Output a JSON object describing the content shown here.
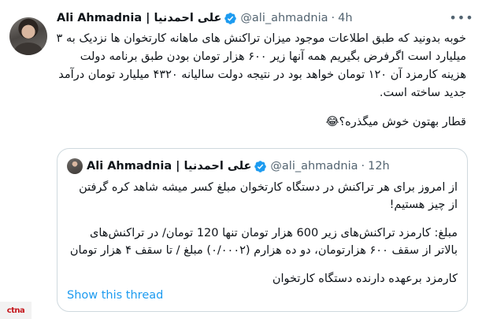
{
  "tweet": {
    "author_name_en": "Ali Ahmadnia",
    "author_name_sep": "|",
    "author_name_fa": "علی احمدنیا",
    "handle": "@ali_ahmadnia",
    "separator": "·",
    "time": "4h",
    "more_icon": "more-horizontal-icon",
    "verified_color": "#1d9bf0",
    "body_lines": [
      "خوبه بدونید که طبق اطلاعات موجود میزان تراکنش های ماهانه کارتخوان ها نزدیک به ۳ میلیارد است اگرفرض بگیریم همه آنها زیر ۶۰۰ هزار تومان بودن طبق برنامه دولت هزینه کارمزد آن ۱۲۰ تومان خواهد بود در نتیجه دولت سالیانه ۴۳۲۰ میلیارد تومان درآمد جدید ساخته است.",
      "قطار بهتون خوش میگذره؟😂"
    ]
  },
  "quoted_tweet": {
    "author_name_en": "Ali Ahmadnia",
    "author_name_sep": "|",
    "author_name_fa": "علی احمدنیا",
    "handle": "@ali_ahmadnia",
    "separator": "·",
    "time": "12h",
    "paragraphs": [
      "از امروز برای هر تراکنش در دستگاه کارتخوان مبلغ کسر میشه شاهد کره گرفتن از چیز هستیم!",
      "مبلغ: کارمزد تراکنش‌های زیر 600 هزار تومان تنها 120 تومان/ در تراکنش‌های بالاتر از سقف ۶۰۰ هزارتومان، دو ده هزارم (۰/۰۰۰۲) مبلغ / تا سقف ۴ هزار تومان",
      "کارمزد برعهده دارنده دستگاه کارتخوان"
    ],
    "show_thread": "Show this thread"
  },
  "watermark": {
    "text": "ctna",
    "color": "#c4161c"
  }
}
